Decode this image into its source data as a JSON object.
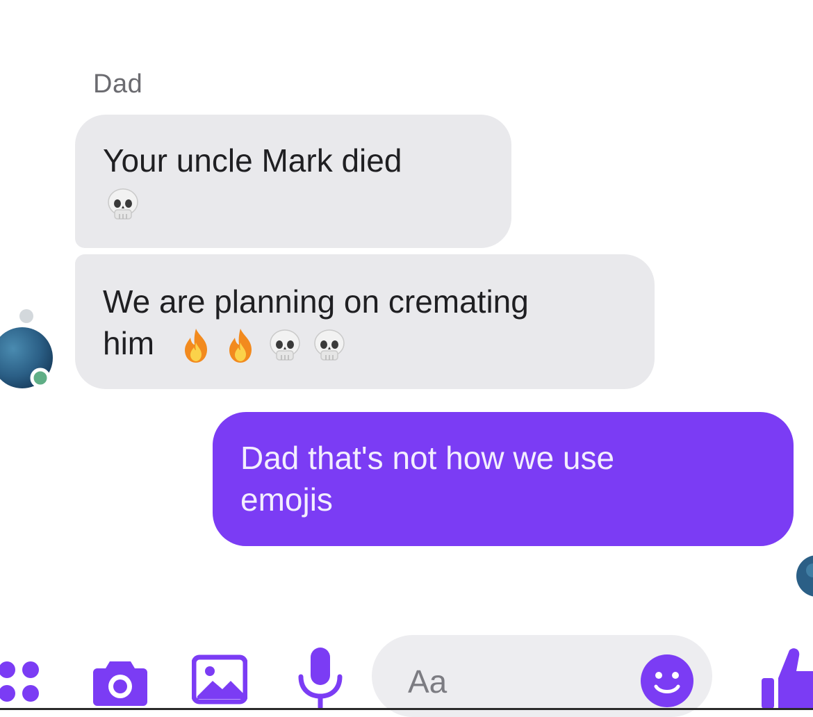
{
  "conversation": {
    "sender_name": "Dad",
    "messages": [
      {
        "direction": "incoming",
        "text": "Your uncle Mark died",
        "emojis": [
          "skull"
        ]
      },
      {
        "direction": "incoming",
        "text": "We are planning on cremating him",
        "line1": "We are planning on cremating",
        "line2": "him",
        "emojis": [
          "fire",
          "fire",
          "skull",
          "skull"
        ]
      },
      {
        "direction": "outgoing",
        "text": "Dad that's not how we use emojis",
        "line1": "Dad that's not how we use",
        "line2": "emojis"
      }
    ]
  },
  "composer": {
    "placeholder": "Aa",
    "tools": [
      "menu-dots-icon",
      "camera-icon",
      "gallery-icon",
      "microphone-icon"
    ],
    "emoji_button": "smiley-icon",
    "send_button": "thumbs-up-icon"
  },
  "colors": {
    "accent": "#7b3cf4",
    "incoming_bubble": "#e9e9ec",
    "background": "#ffffff"
  }
}
